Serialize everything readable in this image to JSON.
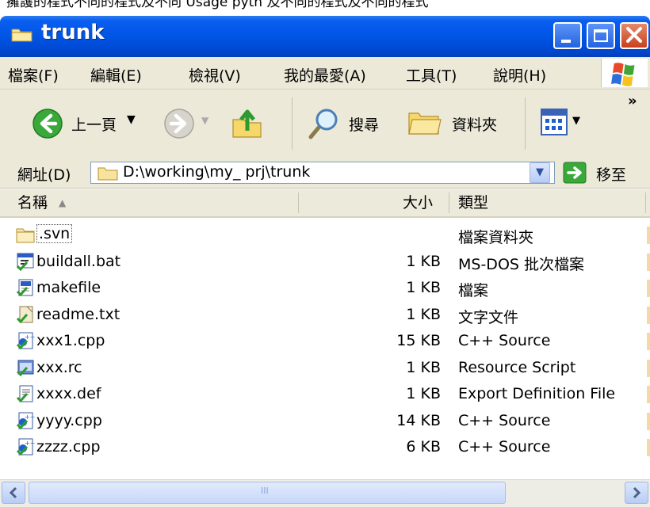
{
  "window": {
    "title": "trunk"
  },
  "menu": [
    "檔案(F)",
    "編輯(E)",
    "檢視(V)",
    "我的最愛(A)",
    "工具(T)",
    "說明(H)"
  ],
  "toolbar": {
    "back_label": "上一頁",
    "search_label": "搜尋",
    "folders_label": "資料夾",
    "more": "»"
  },
  "address": {
    "label": "網址(D)",
    "path": "D:\\working\\my_ prj\\trunk",
    "go_label": "移至"
  },
  "columns": {
    "name": "名稱",
    "size": "大小",
    "type": "類型"
  },
  "files": [
    {
      "name": ".svn",
      "size": "",
      "type": "檔案資料夾",
      "icon": "folder-icon"
    },
    {
      "name": "buildall.bat",
      "size": "1 KB",
      "type": "MS-DOS 批次檔案",
      "icon": "batch-file-icon"
    },
    {
      "name": "makefile",
      "size": "1 KB",
      "type": "檔案",
      "icon": "generic-file-icon"
    },
    {
      "name": "readme.txt",
      "size": "1 KB",
      "type": "文字文件",
      "icon": "text-file-icon"
    },
    {
      "name": "xxx1.cpp",
      "size": "15 KB",
      "type": "C++ Source",
      "icon": "cpp-file-icon"
    },
    {
      "name": "xxx.rc",
      "size": "1 KB",
      "type": "Resource Script",
      "icon": "rc-file-icon"
    },
    {
      "name": "xxxx.def",
      "size": "1 KB",
      "type": "Export Definition File",
      "icon": "def-file-icon"
    },
    {
      "name": "yyyy.cpp",
      "size": "14 KB",
      "type": "C++ Source",
      "icon": "cpp-file-icon"
    },
    {
      "name": "zzzz.cpp",
      "size": "6 KB",
      "type": "C++ Source",
      "icon": "cpp-file-icon"
    }
  ],
  "scroll": {
    "thumb_grip": "III"
  },
  "colors": {
    "titlebar": "#0055e5",
    "chrome": "#ece9d8",
    "svn_ok": "#2f9a2f"
  }
}
